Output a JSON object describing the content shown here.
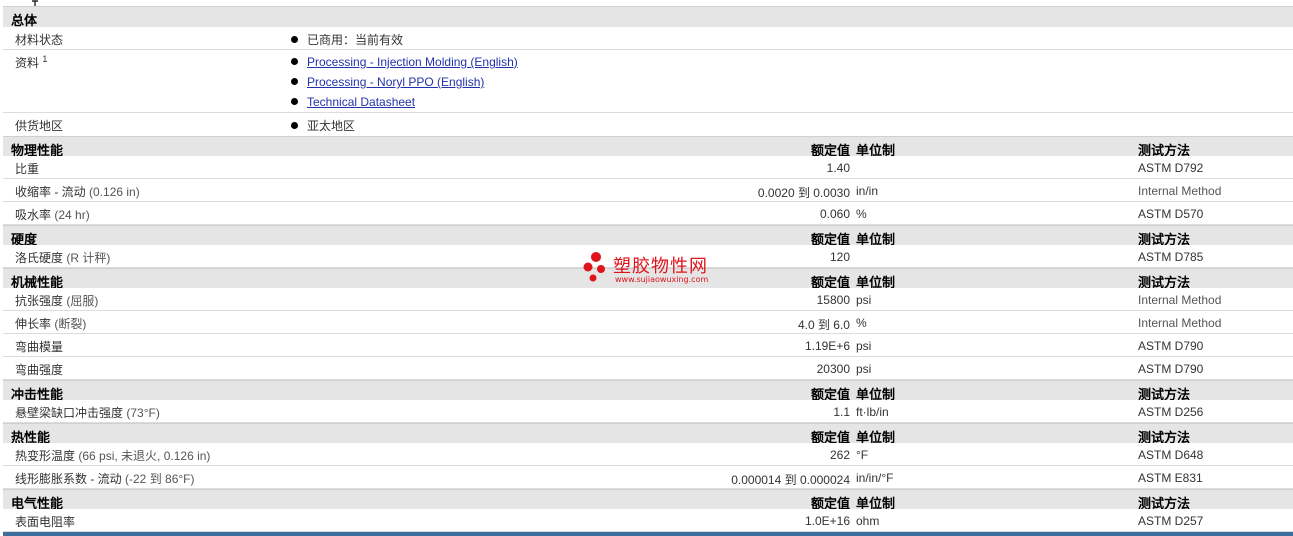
{
  "general": {
    "title": "总体",
    "material_status": {
      "label": "材料状态",
      "value": "已商用：当前有效"
    },
    "documents": {
      "label": "资料",
      "sup": "1",
      "links": [
        "Processing - Injection Molding (English)",
        "Processing - Noryl PPO (English)",
        "Technical Datasheet"
      ]
    },
    "availability": {
      "label": "供货地区",
      "value": "亚太地区"
    }
  },
  "headers": {
    "nominal": "额定值",
    "unit": "单位制",
    "method": "测试方法"
  },
  "sections": {
    "physical": {
      "title": "物理性能",
      "rows": [
        {
          "name": "比重",
          "cond": "",
          "value": "1.40",
          "unit": "",
          "method": "ASTM D792"
        },
        {
          "name": "收缩率 - 流动",
          "cond": "(0.126 in)",
          "value": "0.0020 到  0.0030",
          "unit": "in/in",
          "method": "Internal Method"
        },
        {
          "name": "吸水率",
          "cond": "(24 hr)",
          "value": "0.060",
          "unit": "%",
          "method": "ASTM D570"
        }
      ]
    },
    "hardness": {
      "title": "硬度",
      "rows": [
        {
          "name": "洛氏硬度",
          "cond": "(R 计秤)",
          "value": "120",
          "unit": "",
          "method": "ASTM D785"
        }
      ]
    },
    "mechanical": {
      "title": "机械性能",
      "rows": [
        {
          "name": "抗张强度",
          "cond": "(屈服)",
          "value": "15800",
          "unit": "psi",
          "method": "Internal Method"
        },
        {
          "name": "伸长率",
          "cond": "(断裂)",
          "value": "4.0 到  6.0",
          "unit": "%",
          "method": "Internal Method"
        },
        {
          "name": "弯曲模量",
          "cond": "",
          "value": "1.19E+6",
          "unit": "psi",
          "method": "ASTM D790"
        },
        {
          "name": "弯曲强度",
          "cond": "",
          "value": "20300",
          "unit": "psi",
          "method": "ASTM D790"
        }
      ]
    },
    "impact": {
      "title": "冲击性能",
      "rows": [
        {
          "name": "悬壁梁缺口冲击强度",
          "cond": "(73°F)",
          "value": "1.1",
          "unit": "ft·lb/in",
          "method": "ASTM D256"
        }
      ]
    },
    "thermal": {
      "title": "热性能",
      "rows": [
        {
          "name": "热变形温度",
          "cond": "(66 psi, 未退火, 0.126 in)",
          "value": "262",
          "unit": "°F",
          "method": "ASTM D648"
        },
        {
          "name": "线形膨胀系数 - 流动",
          "cond": "(-22 到  86°F)",
          "value": "0.000014 到  0.000024",
          "unit": "in/in/°F",
          "method": "ASTM E831"
        }
      ]
    },
    "electrical": {
      "title": "电气性能",
      "rows": [
        {
          "name": "表面电阻率",
          "cond": "",
          "value": "1.0E+16",
          "unit": "ohm",
          "method": "ASTM D257"
        }
      ]
    }
  },
  "watermark": {
    "cn": "塑胶物性网",
    "en": "www.sujiaowuxing.com",
    "color": "#e0141c"
  },
  "colors": {
    "section_bg": "#e5e5e5",
    "link": "#2233aa",
    "bottom_bar": "#3d6e9e"
  }
}
